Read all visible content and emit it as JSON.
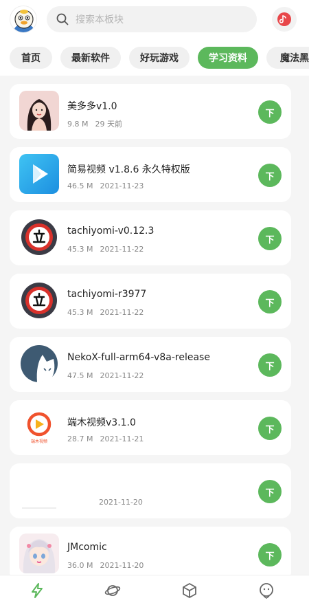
{
  "header": {
    "search_placeholder": "搜索本板块",
    "icons": {
      "avatar": "duck-avatar",
      "search": "search-icon",
      "music": "music-disc-icon"
    }
  },
  "tabs": [
    {
      "label": "首页",
      "active": false
    },
    {
      "label": "最新软件",
      "active": false
    },
    {
      "label": "好玩游戏",
      "active": false
    },
    {
      "label": "学习资料",
      "active": true
    },
    {
      "label": "魔法黑",
      "active": false
    }
  ],
  "download_label": "下",
  "apps": [
    {
      "title": "美多多v1.0",
      "size": "9.8 M",
      "date": "29 天前",
      "icon": "portrait-photo"
    },
    {
      "title": "简易视频 v1.8.6 永久特权版",
      "size": "46.5 M",
      "date": "2021-11-23",
      "icon": "play-triangle"
    },
    {
      "title": "tachiyomi-v0.12.3",
      "size": "45.3 M",
      "date": "2021-11-22",
      "icon": "tachiyomi-sign"
    },
    {
      "title": "tachiyomi-r3977",
      "size": "45.3 M",
      "date": "2021-11-22",
      "icon": "tachiyomi-sign"
    },
    {
      "title": "NekoX-full-arm64-v8a-release",
      "size": "47.5 M",
      "date": "2021-11-22",
      "icon": "neko-cat"
    },
    {
      "title": "端木视频v3.1.0",
      "size": "28.7 M",
      "date": "2021-11-21",
      "icon": "duanmu-play",
      "icon_text": "端木视频"
    },
    {
      "title": "",
      "size": "",
      "date": "2021-11-20",
      "icon": "blank"
    },
    {
      "title": "JMcomic",
      "size": "36.0 M",
      "date": "2021-11-20",
      "icon": "anime-girl"
    }
  ],
  "bottom_nav": [
    "lightning-icon",
    "planet-icon",
    "cube-icon",
    "chat-bot-icon"
  ],
  "colors": {
    "accent": "#5cb85c",
    "background": "#f5f5f5",
    "music_red": "#e8474a",
    "tachiyomi_red": "#d9312b"
  }
}
